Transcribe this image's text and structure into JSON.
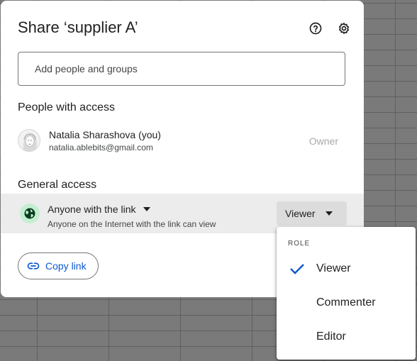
{
  "dialog": {
    "title": "Share ‘supplier A’",
    "help_icon": "help-circle-icon",
    "settings_icon": "gear-icon"
  },
  "add_people": {
    "placeholder": "Add people and groups",
    "value": ""
  },
  "people_section": {
    "heading": "People with access",
    "people": [
      {
        "name": "Natalia Sharashova (you)",
        "email": "natalia.ablebits@gmail.com",
        "role": "Owner"
      }
    ]
  },
  "general_access": {
    "heading": "General access",
    "icon": "globe-icon",
    "scope_label": "Anyone with the link",
    "scope_description": "Anyone on the Internet with the link can view",
    "role_label": "Viewer"
  },
  "copy_link": {
    "label": "Copy link",
    "icon": "link-icon"
  },
  "role_menu": {
    "heading": "ROLE",
    "items": [
      {
        "label": "Viewer",
        "selected": true
      },
      {
        "label": "Commenter",
        "selected": false
      },
      {
        "label": "Editor",
        "selected": false
      }
    ]
  },
  "colors": {
    "accent_blue": "#0b57d0",
    "globe_bg": "#c4eed0",
    "globe_fg": "#0a3d1f",
    "row_highlight": "#ececec"
  }
}
